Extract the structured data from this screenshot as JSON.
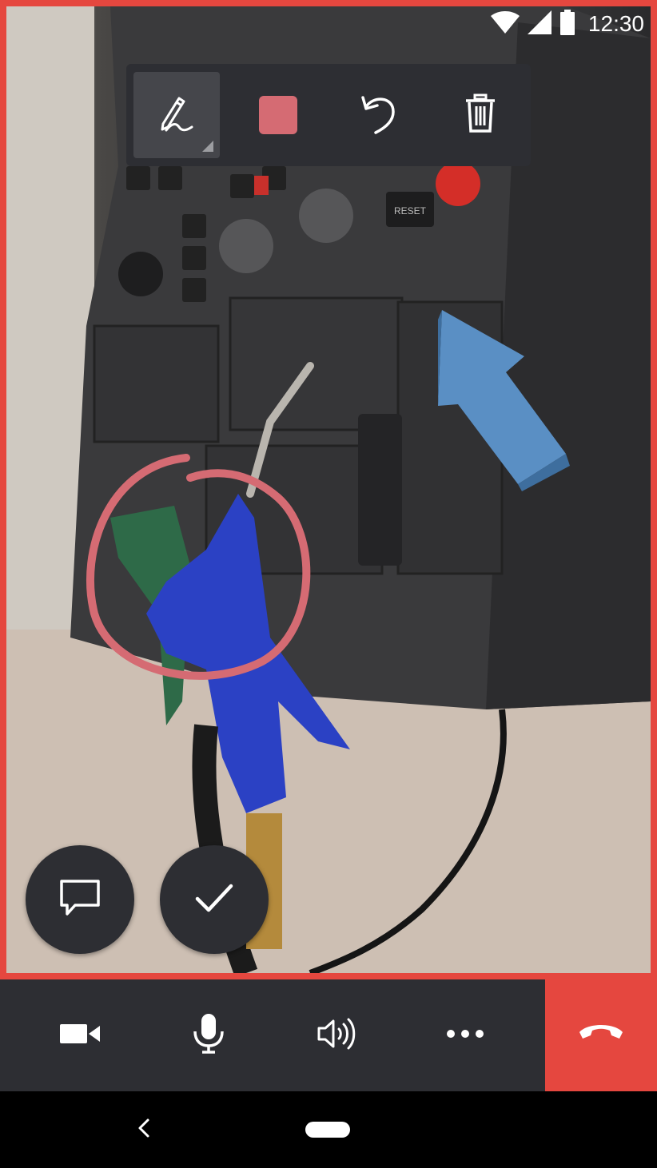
{
  "status_bar": {
    "time": "12:30"
  },
  "annotation_toolbar": {
    "tools": [
      "pen-tool",
      "color-picker",
      "undo",
      "delete"
    ],
    "selected_tool": "pen-tool",
    "selected_color": "#d56b73"
  },
  "annotations": {
    "circle_color": "#d56b73",
    "arrow_color": "#5a8fc4"
  },
  "camera_feed": {
    "visible_label": "RESET"
  },
  "call_controls": {
    "items": [
      "video-camera",
      "microphone",
      "speaker",
      "more"
    ],
    "hangup_color": "#e5473f"
  },
  "colors": {
    "frame": "#e5473f",
    "toolbar": "#2d2e33",
    "active_tool_bg": "#45464b"
  }
}
